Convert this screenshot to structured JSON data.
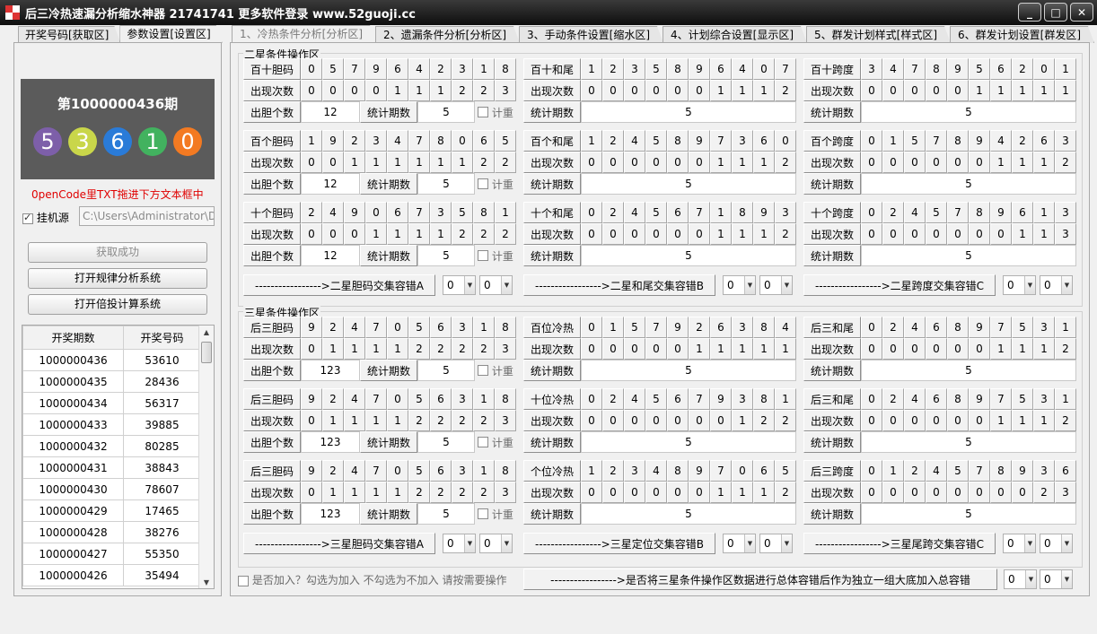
{
  "window": {
    "title": "后三冷热速漏分析缩水神器 21741741 更多软件登录 www.52guoji.cc",
    "min": "_",
    "max": "□",
    "close": "✕"
  },
  "left_tabs": [
    "开奖号码[获取区]",
    "参数设置[设置区]"
  ],
  "main_tabs": [
    "1、冷热条件分析[分析区]",
    "2、遗漏条件分析[分析区]",
    "3、手动条件设置[缩水区]",
    "4、计划综合设置[显示区]",
    "5、群发计划样式[样式区]",
    "6、群发计划设置[群发区]"
  ],
  "display": {
    "period": "第1000000436期",
    "balls": [
      {
        "n": "5",
        "c": "#7d5fa9"
      },
      {
        "n": "3",
        "c": "#c9d64a"
      },
      {
        "n": "6",
        "c": "#2a7bd8"
      },
      {
        "n": "1",
        "c": "#42b25f"
      },
      {
        "n": "0",
        "c": "#f37a22"
      }
    ]
  },
  "hint": "0penCode里TXT拖进下方文本框中",
  "source": {
    "label": "挂机源",
    "path": "C:\\Users\\Administrator\\De"
  },
  "buttons": {
    "fetch": "获取成功",
    "rule": "打开规律分析系统",
    "bet": "打开倍投计算系统"
  },
  "history": {
    "headers": [
      "开奖期数",
      "开奖号码"
    ],
    "rows": [
      [
        "1000000436",
        "53610"
      ],
      [
        "1000000435",
        "28436"
      ],
      [
        "1000000434",
        "56317"
      ],
      [
        "1000000433",
        "39885"
      ],
      [
        "1000000432",
        "80285"
      ],
      [
        "1000000431",
        "38843"
      ],
      [
        "1000000430",
        "78607"
      ],
      [
        "1000000429",
        "17465"
      ],
      [
        "1000000428",
        "38276"
      ],
      [
        "1000000427",
        "55350"
      ],
      [
        "1000000426",
        "35494"
      ]
    ]
  },
  "sections": [
    {
      "legend": "二星条件操作区",
      "cross": [
        "----------------->二星胆码交集容错A",
        "----------------->二星和尾交集容错B",
        "----------------->二星跨度交集容错C"
      ],
      "combos": [
        [
          "0",
          "0"
        ],
        [
          "0",
          "0"
        ],
        [
          "0",
          "0"
        ]
      ],
      "rows": [
        [
          {
            "t": "dan",
            "title": "百十胆码",
            "nums": [
              "0",
              "5",
              "7",
              "9",
              "6",
              "4",
              "2",
              "3",
              "1",
              "8"
            ],
            "cnt": [
              "0",
              "0",
              "0",
              "0",
              "1",
              "1",
              "1",
              "2",
              "2",
              "3"
            ],
            "cntl": "出现次数",
            "dl": "出胆个数",
            "dv": "12",
            "sl": "统计期数",
            "sv": "5",
            "ck": "计重"
          },
          {
            "t": "sum",
            "title": "百十和尾",
            "nums": [
              "1",
              "2",
              "3",
              "5",
              "8",
              "9",
              "6",
              "4",
              "0",
              "7"
            ],
            "cnt": [
              "0",
              "0",
              "0",
              "0",
              "0",
              "0",
              "1",
              "1",
              "1",
              "2"
            ],
            "cntl": "出现次数",
            "sl": "统计期数",
            "sv": "5"
          },
          {
            "t": "sum",
            "title": "百十跨度",
            "nums": [
              "3",
              "4",
              "7",
              "8",
              "9",
              "5",
              "6",
              "2",
              "0",
              "1"
            ],
            "cnt": [
              "0",
              "0",
              "0",
              "0",
              "0",
              "1",
              "1",
              "1",
              "1",
              "1"
            ],
            "cntl": "出现次数",
            "sl": "统计期数",
            "sv": "5"
          }
        ],
        [
          {
            "t": "dan",
            "title": "百个胆码",
            "nums": [
              "1",
              "9",
              "2",
              "3",
              "4",
              "7",
              "8",
              "0",
              "6",
              "5"
            ],
            "cnt": [
              "0",
              "0",
              "1",
              "1",
              "1",
              "1",
              "1",
              "1",
              "2",
              "2"
            ],
            "cntl": "出现次数",
            "dl": "出胆个数",
            "dv": "12",
            "sl": "统计期数",
            "sv": "5",
            "ck": "计重"
          },
          {
            "t": "sum",
            "title": "百个和尾",
            "nums": [
              "1",
              "2",
              "4",
              "5",
              "8",
              "9",
              "7",
              "3",
              "6",
              "0"
            ],
            "cnt": [
              "0",
              "0",
              "0",
              "0",
              "0",
              "0",
              "1",
              "1",
              "1",
              "2"
            ],
            "cntl": "出现次数",
            "sl": "统计期数",
            "sv": "5"
          },
          {
            "t": "sum",
            "title": "百个跨度",
            "nums": [
              "0",
              "1",
              "5",
              "7",
              "8",
              "9",
              "4",
              "2",
              "6",
              "3"
            ],
            "cnt": [
              "0",
              "0",
              "0",
              "0",
              "0",
              "0",
              "1",
              "1",
              "1",
              "2"
            ],
            "cntl": "出现次数",
            "sl": "统计期数",
            "sv": "5"
          }
        ],
        [
          {
            "t": "dan",
            "title": "十个胆码",
            "nums": [
              "2",
              "4",
              "9",
              "0",
              "6",
              "7",
              "3",
              "5",
              "8",
              "1"
            ],
            "cnt": [
              "0",
              "0",
              "0",
              "1",
              "1",
              "1",
              "1",
              "2",
              "2",
              "2"
            ],
            "cntl": "出现次数",
            "dl": "出胆个数",
            "dv": "12",
            "sl": "统计期数",
            "sv": "5",
            "ck": "计重"
          },
          {
            "t": "sum",
            "title": "十个和尾",
            "nums": [
              "0",
              "2",
              "4",
              "5",
              "6",
              "7",
              "1",
              "8",
              "9",
              "3"
            ],
            "cnt": [
              "0",
              "0",
              "0",
              "0",
              "0",
              "0",
              "1",
              "1",
              "1",
              "2"
            ],
            "cntl": "出现次数",
            "sl": "统计期数",
            "sv": "5"
          },
          {
            "t": "sum",
            "title": "十个跨度",
            "nums": [
              "0",
              "2",
              "4",
              "5",
              "7",
              "8",
              "9",
              "6",
              "1",
              "3"
            ],
            "cnt": [
              "0",
              "0",
              "0",
              "0",
              "0",
              "0",
              "0",
              "1",
              "1",
              "3"
            ],
            "cntl": "出现次数",
            "sl": "统计期数",
            "sv": "5"
          }
        ]
      ]
    },
    {
      "legend": "三星条件操作区",
      "cross": [
        "----------------->三星胆码交集容错A",
        "----------------->三星定位交集容错B",
        "----------------->三星尾跨交集容错C"
      ],
      "combos": [
        [
          "0",
          "0"
        ],
        [
          "0",
          "0"
        ],
        [
          "0",
          "0"
        ]
      ],
      "rows": [
        [
          {
            "t": "dan",
            "title": "后三胆码",
            "nums": [
              "9",
              "2",
              "4",
              "7",
              "0",
              "5",
              "6",
              "3",
              "1",
              "8"
            ],
            "cnt": [
              "0",
              "1",
              "1",
              "1",
              "1",
              "2",
              "2",
              "2",
              "2",
              "3"
            ],
            "cntl": "出现次数",
            "dl": "出胆个数",
            "dv": "123",
            "sl": "统计期数",
            "sv": "5",
            "ck": "计重"
          },
          {
            "t": "sum",
            "title": "百位冷热",
            "nums": [
              "0",
              "1",
              "5",
              "7",
              "9",
              "2",
              "6",
              "3",
              "8",
              "4"
            ],
            "cnt": [
              "0",
              "0",
              "0",
              "0",
              "0",
              "1",
              "1",
              "1",
              "1",
              "1"
            ],
            "cntl": "出现次数",
            "sl": "统计期数",
            "sv": "5"
          },
          {
            "t": "sum",
            "title": "后三和尾",
            "nums": [
              "0",
              "2",
              "4",
              "6",
              "8",
              "9",
              "7",
              "5",
              "3",
              "1"
            ],
            "cnt": [
              "0",
              "0",
              "0",
              "0",
              "0",
              "0",
              "1",
              "1",
              "1",
              "2"
            ],
            "cntl": "出现次数",
            "sl": "统计期数",
            "sv": "5"
          }
        ],
        [
          {
            "t": "dan",
            "title": "后三胆码",
            "nums": [
              "9",
              "2",
              "4",
              "7",
              "0",
              "5",
              "6",
              "3",
              "1",
              "8"
            ],
            "cnt": [
              "0",
              "1",
              "1",
              "1",
              "1",
              "2",
              "2",
              "2",
              "2",
              "3"
            ],
            "cntl": "出现次数",
            "dl": "出胆个数",
            "dv": "123",
            "sl": "统计期数",
            "sv": "5",
            "ck": "计重"
          },
          {
            "t": "sum",
            "title": "十位冷热",
            "nums": [
              "0",
              "2",
              "4",
              "5",
              "6",
              "7",
              "9",
              "3",
              "8",
              "1"
            ],
            "cnt": [
              "0",
              "0",
              "0",
              "0",
              "0",
              "0",
              "0",
              "1",
              "2",
              "2"
            ],
            "cntl": "出现次数",
            "sl": "统计期数",
            "sv": "5"
          },
          {
            "t": "sum",
            "title": "后三和尾",
            "nums": [
              "0",
              "2",
              "4",
              "6",
              "8",
              "9",
              "7",
              "5",
              "3",
              "1"
            ],
            "cnt": [
              "0",
              "0",
              "0",
              "0",
              "0",
              "0",
              "1",
              "1",
              "1",
              "2"
            ],
            "cntl": "出现次数",
            "sl": "统计期数",
            "sv": "5"
          }
        ],
        [
          {
            "t": "dan",
            "title": "后三胆码",
            "nums": [
              "9",
              "2",
              "4",
              "7",
              "0",
              "5",
              "6",
              "3",
              "1",
              "8"
            ],
            "cnt": [
              "0",
              "1",
              "1",
              "1",
              "1",
              "2",
              "2",
              "2",
              "2",
              "3"
            ],
            "cntl": "出现次数",
            "dl": "出胆个数",
            "dv": "123",
            "sl": "统计期数",
            "sv": "5",
            "ck": "计重"
          },
          {
            "t": "sum",
            "title": "个位冷热",
            "nums": [
              "1",
              "2",
              "3",
              "4",
              "8",
              "9",
              "7",
              "0",
              "6",
              "5"
            ],
            "cnt": [
              "0",
              "0",
              "0",
              "0",
              "0",
              "0",
              "1",
              "1",
              "1",
              "2"
            ],
            "cntl": "出现次数",
            "sl": "统计期数",
            "sv": "5"
          },
          {
            "t": "sum",
            "title": "后三跨度",
            "nums": [
              "0",
              "1",
              "2",
              "4",
              "5",
              "7",
              "8",
              "9",
              "3",
              "6"
            ],
            "cnt": [
              "0",
              "0",
              "0",
              "0",
              "0",
              "0",
              "0",
              "0",
              "2",
              "3"
            ],
            "cntl": "出现次数",
            "sl": "统计期数",
            "sv": "5"
          }
        ]
      ]
    }
  ],
  "bottom": {
    "check": "是否加入？勾选为加入 不勾选为不加入 请按需要操作",
    "cross": "----------------->是否将三星条件操作区数据进行总体容错后作为独立一组大底加入总容错",
    "combos": [
      "0",
      "0"
    ]
  }
}
